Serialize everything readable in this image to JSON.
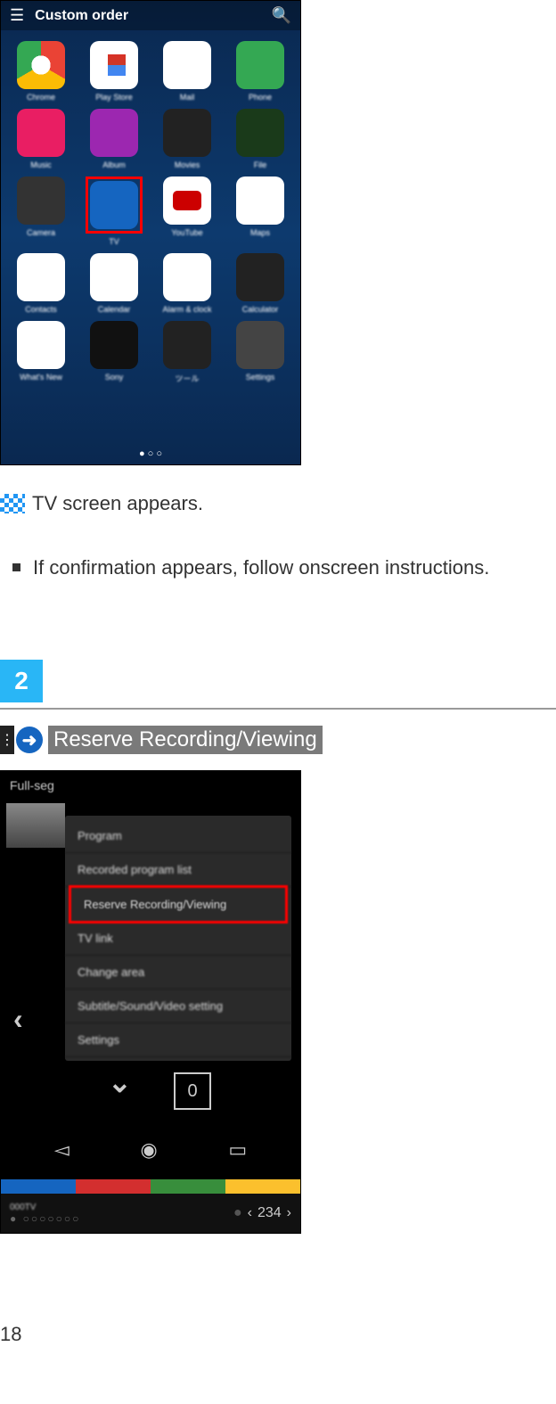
{
  "screen1": {
    "title": "Custom order",
    "apps": [
      {
        "label": "Chrome",
        "cls": "chrome-ico"
      },
      {
        "label": "Play Store",
        "cls": "play-ico"
      },
      {
        "label": "Mail",
        "cls": "msg-ico"
      },
      {
        "label": "Phone",
        "cls": "phone-ico"
      },
      {
        "label": "Music",
        "cls": "music-ico"
      },
      {
        "label": "Album",
        "cls": "album-ico"
      },
      {
        "label": "Movies",
        "cls": "dark-ico"
      },
      {
        "label": "File",
        "cls": "green-ico"
      },
      {
        "label": "Camera",
        "cls": "camera-ico"
      },
      {
        "label": "TV",
        "cls": "tv-ico",
        "hl": true
      },
      {
        "label": "YouTube",
        "cls": "yt-ico"
      },
      {
        "label": "Maps",
        "cls": "maps-ico"
      },
      {
        "label": "Contacts",
        "cls": "contacts-ico"
      },
      {
        "label": "Calendar",
        "cls": "cal-ico"
      },
      {
        "label": "Alarm & clock",
        "cls": "clock-ico"
      },
      {
        "label": "Calculator",
        "cls": "calc-ico"
      },
      {
        "label": "What's New",
        "cls": "whats-ico"
      },
      {
        "label": "Sony",
        "cls": "sony-ico"
      },
      {
        "label": "ツール",
        "cls": "dark-ico"
      },
      {
        "label": "Settings",
        "cls": "gear-ico"
      }
    ],
    "pager": "●  ○  ○"
  },
  "result": "TV screen appears.",
  "bullet": "If confirmation appears, follow onscreen instructions.",
  "step2": {
    "number": "2",
    "action": "Reserve Recording/Viewing"
  },
  "screen2": {
    "header": "Full-seg",
    "menu": [
      "Program",
      "Recorded program list",
      "Reserve Recording/Viewing",
      "TV link",
      "Change area",
      "Subtitle/Sound/Video setting",
      "Settings"
    ],
    "selected_index": 2,
    "vol": "0",
    "channel": "234",
    "signal": "● ○○○○○○○"
  },
  "page_number": "18"
}
